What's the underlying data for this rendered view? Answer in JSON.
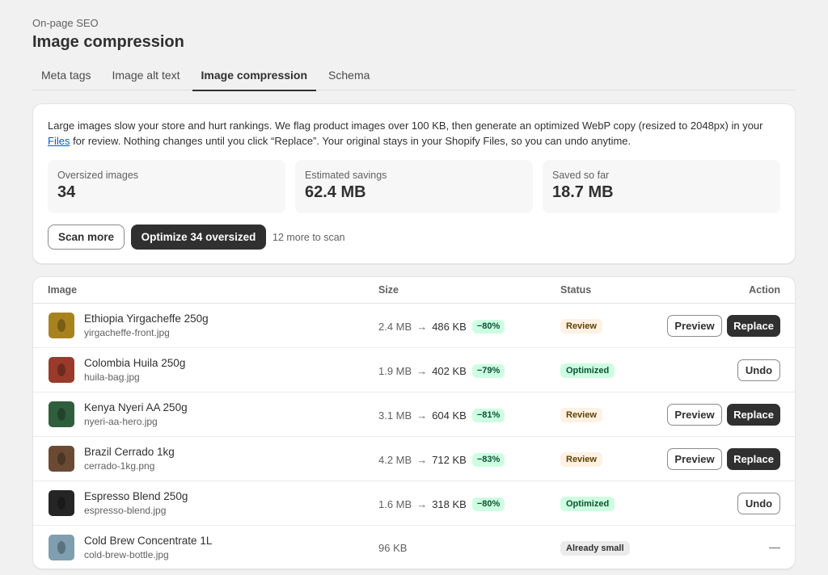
{
  "header": {
    "eyebrow": "On-page SEO",
    "title": "Image compression"
  },
  "tabs": [
    {
      "label": "Meta tags",
      "active": false
    },
    {
      "label": "Image alt text",
      "active": false
    },
    {
      "label": "Image compression",
      "active": true
    },
    {
      "label": "Schema",
      "active": false
    }
  ],
  "intro": {
    "text_before": "Large images slow your store and hurt rankings. We flag product images over 100 KB, then generate an optimized WebP copy (resized to 2048px) in your ",
    "link": "Files",
    "text_after": " for review. Nothing changes until you click “Replace”. Your original stays in your Shopify Files, so you can undo anytime."
  },
  "stats": [
    {
      "label": "Oversized images",
      "value": "34"
    },
    {
      "label": "Estimated savings",
      "value": "62.4 MB"
    },
    {
      "label": "Saved so far",
      "value": "18.7 MB"
    }
  ],
  "actions": {
    "scan_more": "Scan more",
    "optimize": "Optimize 34 oversized",
    "scan_note": "12 more to scan"
  },
  "table": {
    "columns": {
      "image": "Image",
      "size": "Size",
      "status": "Status",
      "action": "Action"
    },
    "arrow": "→",
    "rows": [
      {
        "name": "Ethiopia Yirgacheffe 250g",
        "file": "yirgacheffe-front.jpg",
        "orig": "2.4 MB",
        "new": "486 KB",
        "pct": "−80%",
        "status": "Review",
        "status_type": "review",
        "thumb_color": "#a8821e",
        "actions": [
          "Preview",
          "Replace"
        ]
      },
      {
        "name": "Colombia Huila 250g",
        "file": "huila-bag.jpg",
        "orig": "1.9 MB",
        "new": "402 KB",
        "pct": "−79%",
        "status": "Optimized",
        "status_type": "optimized",
        "thumb_color": "#9a3a2a",
        "actions": [
          "Undo"
        ]
      },
      {
        "name": "Kenya Nyeri AA 250g",
        "file": "nyeri-aa-hero.jpg",
        "orig": "3.1 MB",
        "new": "604 KB",
        "pct": "−81%",
        "status": "Review",
        "status_type": "review",
        "thumb_color": "#2f5e3c",
        "actions": [
          "Preview",
          "Replace"
        ]
      },
      {
        "name": "Brazil Cerrado 1kg",
        "file": "cerrado-1kg.png",
        "orig": "4.2 MB",
        "new": "712 KB",
        "pct": "−83%",
        "status": "Review",
        "status_type": "review",
        "thumb_color": "#6b4a34",
        "actions": [
          "Preview",
          "Replace"
        ]
      },
      {
        "name": "Espresso Blend 250g",
        "file": "espresso-blend.jpg",
        "orig": "1.6 MB",
        "new": "318 KB",
        "pct": "−80%",
        "status": "Optimized",
        "status_type": "optimized",
        "thumb_color": "#252525",
        "actions": [
          "Undo"
        ]
      },
      {
        "name": "Cold Brew Concentrate 1L",
        "file": "cold-brew-bottle.jpg",
        "orig": "96 KB",
        "new": "",
        "pct": "",
        "status": "Already small",
        "status_type": "small",
        "thumb_color": "#7f9eb0",
        "actions": []
      }
    ],
    "no_action": "—"
  }
}
